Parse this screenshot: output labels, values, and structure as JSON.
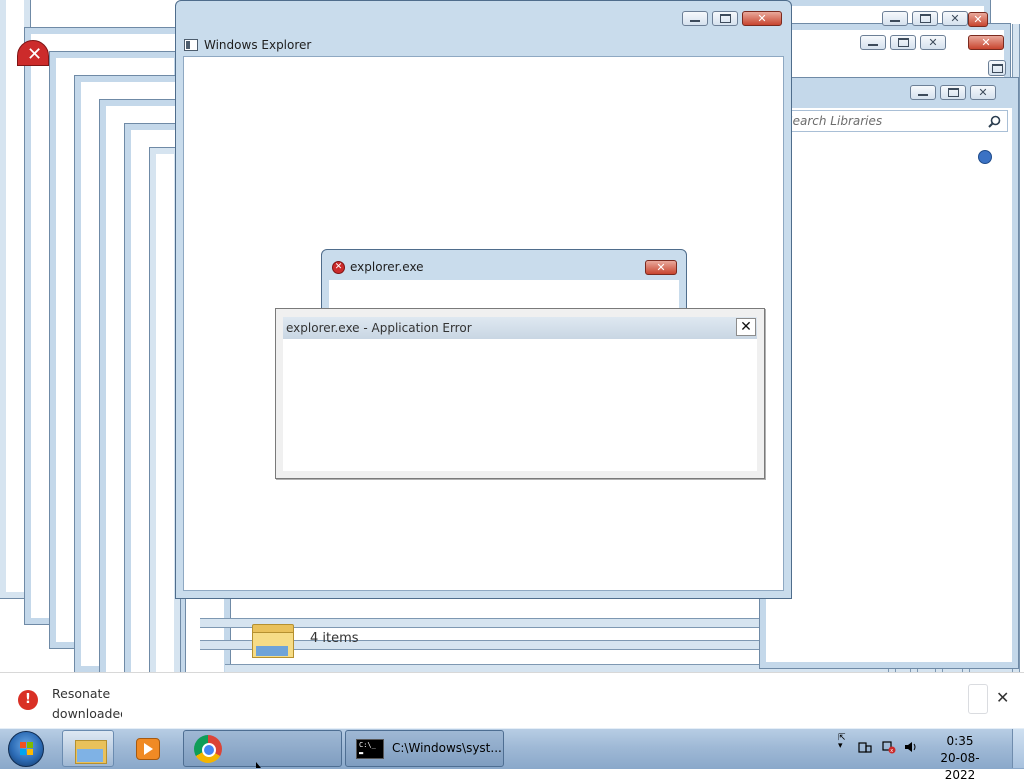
{
  "colors": {
    "frame_blue": "#c4d8ea",
    "taskbar": "#9fb9d6",
    "error_red": "#cc2b2b",
    "close_red": "#c8452f"
  },
  "main_window": {
    "title": "Windows Explorer",
    "icon": "window-icon"
  },
  "libraries_window": {
    "search_placeholder": "Search Libraries",
    "search_icon": "search-icon",
    "status_items": "4 items"
  },
  "error_dialog": {
    "title": "explorer.exe",
    "icon": "error-icon"
  },
  "app_error_dialog": {
    "title": "explorer.exe - Application Error",
    "close_label": "✕"
  },
  "download_bar": {
    "line1": "Resonate",
    "line2": "downloaded",
    "close_label": "✕",
    "icon": "error-icon"
  },
  "taskbar": {
    "items": [
      {
        "name": "start",
        "icon": "windows-logo-icon"
      },
      {
        "name": "explorer",
        "icon": "folder-icon"
      },
      {
        "name": "media",
        "icon": "media-player-icon"
      },
      {
        "name": "chrome",
        "icon": "chrome-icon"
      },
      {
        "name": "cmd",
        "icon": "cmd-icon",
        "label": "C:\\Windows\\syst..."
      }
    ],
    "clock_time": "0:35",
    "clock_date": "20-08-2022"
  },
  "window_controls": {
    "minimize": "minimize-icon",
    "maximize": "maximize-icon",
    "close": "close-icon"
  }
}
